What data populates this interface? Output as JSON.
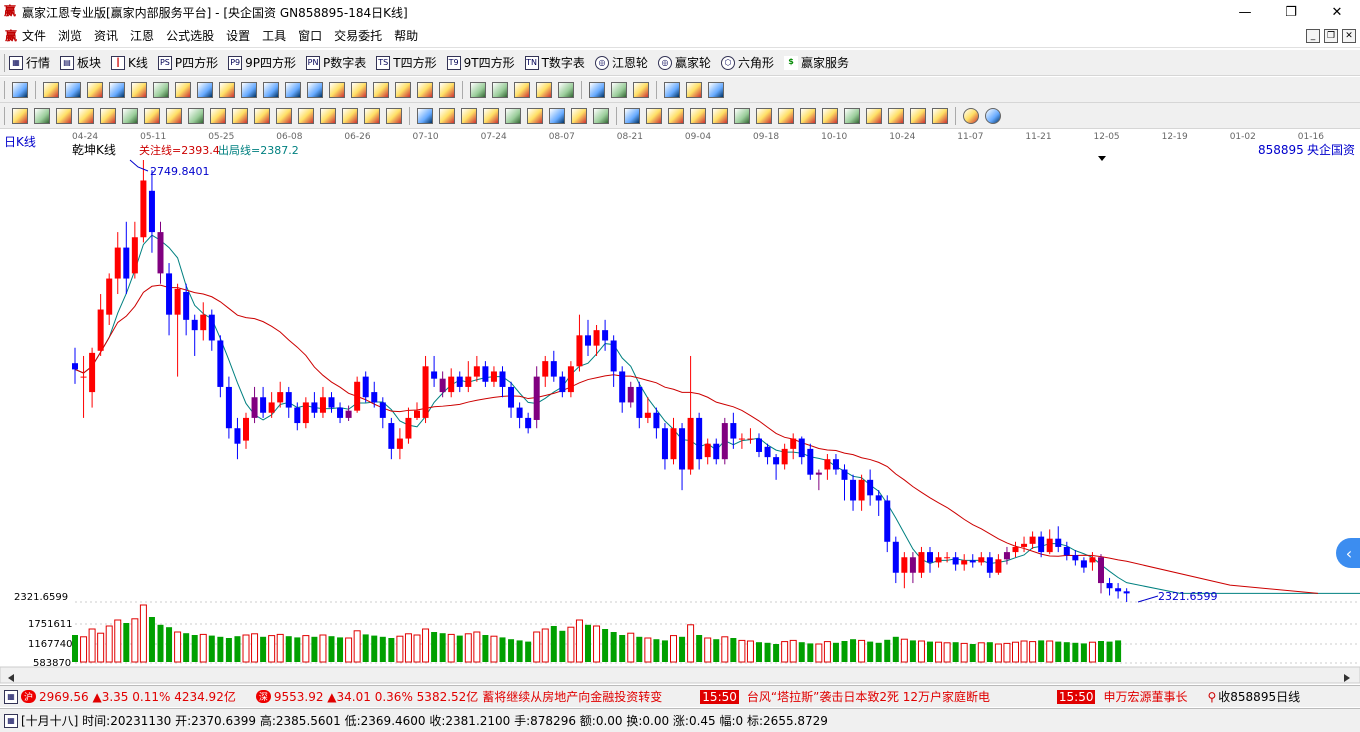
{
  "window": {
    "title": "赢家江恩专业版[赢家内部服务平台] - [央企国资  GN858895-184日K线]",
    "logo": "赢",
    "minimize": "—",
    "maximize": "❐",
    "close": "✕"
  },
  "menu": {
    "logo": "赢",
    "items": [
      "文件",
      "浏览",
      "资讯",
      "江恩",
      "公式选股",
      "设置",
      "工具",
      "窗口",
      "交易委托",
      "帮助"
    ]
  },
  "toolbar1": [
    {
      "icon": "grid-icon",
      "label": "行情"
    },
    {
      "icon": "blocks-icon",
      "label": "板块"
    },
    {
      "icon": "kline-icon",
      "label": "K线"
    },
    {
      "icon": "PS",
      "label": "P四方形"
    },
    {
      "icon": "P9",
      "label": "9P四方形"
    },
    {
      "icon": "PN",
      "label": "P数字表"
    },
    {
      "icon": "TS",
      "label": "T四方形"
    },
    {
      "icon": "T9",
      "label": "9T四方形"
    },
    {
      "icon": "TN",
      "label": "T数字表"
    },
    {
      "icon": "wheel-icon",
      "label": "江恩轮"
    },
    {
      "icon": "wheel-icon",
      "label": "赢家轮"
    },
    {
      "icon": "wheel-icon",
      "label": "六角形"
    },
    {
      "icon": "dollar-icon",
      "label": "赢家服务"
    }
  ],
  "chart": {
    "period_label": "日K线",
    "indicator_name": "乾坤K线",
    "focus_line_label": "关注线=2393.4",
    "exit_line_label": "出局线=2387.2",
    "code": "858895",
    "name": "央企国资",
    "high_label": "2749.8401",
    "low_label": "2321.6599",
    "axis_price_label": "2321.6599",
    "vol_labels": [
      "1751611",
      "1167740",
      "583870"
    ],
    "dates": [
      "04-24",
      "05-11",
      "05-25",
      "06-08",
      "06-26",
      "07-10",
      "07-24",
      "08-07",
      "08-21",
      "09-04",
      "09-18",
      "10-10",
      "10-24",
      "11-07",
      "11-21",
      "12-05",
      "12-19",
      "01-02",
      "01-16"
    ],
    "colors": {
      "up": "#ff0000",
      "down": "#0000ff",
      "purple": "#800080",
      "ma_short": "#008080",
      "ma_long": "#cc0000",
      "vol_up": "#e00000",
      "vol_down": "#00a000"
    }
  },
  "chart_data": {
    "type": "candlestick",
    "price_range": [
      2321.6599,
      2749.8401
    ],
    "candles": [
      [
        2553,
        2547,
        2568,
        2533
      ],
      [
        2540,
        2540,
        2560,
        2500
      ],
      [
        2525,
        2563,
        2568,
        2510
      ],
      [
        2565,
        2605,
        2620,
        2560
      ],
      [
        2600,
        2635,
        2640,
        2590
      ],
      [
        2635,
        2665,
        2680,
        2620
      ],
      [
        2665,
        2635,
        2690,
        2620
      ],
      [
        2640,
        2675,
        2690,
        2635
      ],
      [
        2675,
        2730,
        2749.84,
        2670
      ],
      [
        2720,
        2680,
        2740,
        2660
      ],
      [
        2680,
        2640,
        2690,
        2630
      ],
      [
        2640,
        2600,
        2650,
        2580
      ],
      [
        2600,
        2625,
        2630,
        2540
      ],
      [
        2622,
        2595,
        2630,
        2580
      ],
      [
        2595,
        2585,
        2600,
        2560
      ],
      [
        2585,
        2600,
        2612,
        2575
      ],
      [
        2600,
        2575,
        2605,
        2565
      ],
      [
        2575,
        2530,
        2580,
        2520
      ],
      [
        2530,
        2490,
        2540,
        2480
      ],
      [
        2490,
        2475,
        2500,
        2460
      ],
      [
        2478,
        2500,
        2505,
        2470
      ],
      [
        2500,
        2520,
        2530,
        2495
      ],
      [
        2520,
        2505,
        2530,
        2500
      ],
      [
        2505,
        2515,
        2525,
        2500
      ],
      [
        2515,
        2525,
        2535,
        2510
      ],
      [
        2525,
        2510,
        2530,
        2500
      ],
      [
        2510,
        2495,
        2515,
        2488
      ],
      [
        2495,
        2515,
        2520,
        2490
      ],
      [
        2515,
        2505,
        2525,
        2500
      ],
      [
        2505,
        2520,
        2530,
        2500
      ],
      [
        2520,
        2510,
        2525,
        2505
      ],
      [
        2510,
        2500,
        2515,
        2495
      ],
      [
        2500,
        2507,
        2512,
        2497
      ],
      [
        2507,
        2535,
        2540,
        2505
      ],
      [
        2540,
        2520,
        2545,
        2515
      ],
      [
        2525,
        2515,
        2535,
        2510
      ],
      [
        2515,
        2500,
        2520,
        2490
      ],
      [
        2495,
        2470,
        2500,
        2460
      ],
      [
        2470,
        2480,
        2490,
        2460
      ],
      [
        2480,
        2500,
        2510,
        2475
      ],
      [
        2500,
        2507,
        2515,
        2498
      ],
      [
        2500,
        2550,
        2560,
        2495
      ],
      [
        2545,
        2538,
        2560,
        2530
      ],
      [
        2538,
        2525,
        2545,
        2520
      ],
      [
        2525,
        2540,
        2548,
        2520
      ],
      [
        2540,
        2530,
        2545,
        2525
      ],
      [
        2530,
        2540,
        2555,
        2525
      ],
      [
        2540,
        2550,
        2560,
        2535
      ],
      [
        2550,
        2535,
        2555,
        2530
      ],
      [
        2535,
        2545,
        2550,
        2530
      ],
      [
        2545,
        2530,
        2550,
        2520
      ],
      [
        2530,
        2510,
        2535,
        2500
      ],
      [
        2510,
        2500,
        2515,
        2490
      ],
      [
        2500,
        2490,
        2505,
        2485
      ],
      [
        2498,
        2540,
        2550,
        2490
      ],
      [
        2540,
        2555,
        2560,
        2530
      ],
      [
        2555,
        2540,
        2565,
        2535
      ],
      [
        2540,
        2525,
        2545,
        2520
      ],
      [
        2525,
        2550,
        2555,
        2520
      ],
      [
        2550,
        2580,
        2600,
        2545
      ],
      [
        2580,
        2570,
        2595,
        2560
      ],
      [
        2570,
        2585,
        2590,
        2560
      ],
      [
        2585,
        2575,
        2595,
        2565
      ],
      [
        2575,
        2545,
        2580,
        2530
      ],
      [
        2545,
        2515,
        2550,
        2505
      ],
      [
        2515,
        2530,
        2535,
        2510
      ],
      [
        2530,
        2500,
        2535,
        2490
      ],
      [
        2500,
        2505,
        2520,
        2495
      ],
      [
        2505,
        2490,
        2510,
        2480
      ],
      [
        2490,
        2460,
        2495,
        2450
      ],
      [
        2460,
        2490,
        2500,
        2455
      ],
      [
        2490,
        2450,
        2495,
        2430
      ],
      [
        2450,
        2500,
        2560,
        2445
      ],
      [
        2500,
        2460,
        2505,
        2450
      ],
      [
        2462,
        2475,
        2480,
        2455
      ],
      [
        2475,
        2460,
        2480,
        2455
      ],
      [
        2460,
        2495,
        2500,
        2455
      ],
      [
        2495,
        2480,
        2505,
        2470
      ],
      [
        2480,
        2480,
        2485,
        2470
      ],
      [
        2480,
        2480,
        2490,
        2475
      ],
      [
        2480,
        2467,
        2485,
        2462
      ],
      [
        2472,
        2462,
        2475,
        2455
      ],
      [
        2462,
        2455,
        2465,
        2440
      ],
      [
        2455,
        2470,
        2475,
        2450
      ],
      [
        2470,
        2480,
        2485,
        2460
      ],
      [
        2480,
        2462,
        2482,
        2455
      ],
      [
        2470,
        2445,
        2475,
        2440
      ],
      [
        2445,
        2447,
        2450,
        2430
      ],
      [
        2450,
        2460,
        2465,
        2440
      ],
      [
        2460,
        2450,
        2465,
        2445
      ],
      [
        2450,
        2440,
        2455,
        2420
      ],
      [
        2440,
        2420,
        2445,
        2410
      ],
      [
        2420,
        2440,
        2445,
        2410
      ],
      [
        2440,
        2425,
        2450,
        2415
      ],
      [
        2425,
        2420,
        2430,
        2405
      ],
      [
        2420,
        2380,
        2425,
        2370
      ],
      [
        2380,
        2350,
        2385,
        2340
      ],
      [
        2350,
        2365,
        2370,
        2335
      ],
      [
        2365,
        2350,
        2370,
        2340
      ],
      [
        2350,
        2370,
        2375,
        2345
      ],
      [
        2370,
        2360,
        2375,
        2350
      ],
      [
        2360,
        2365,
        2370,
        2355
      ],
      [
        2365,
        2365,
        2370,
        2360
      ],
      [
        2365,
        2358,
        2370,
        2352
      ],
      [
        2358,
        2362,
        2368,
        2352
      ],
      [
        2362,
        2360,
        2368,
        2355
      ],
      [
        2360,
        2365,
        2370,
        2357
      ],
      [
        2365,
        2350,
        2370,
        2345
      ],
      [
        2350,
        2363,
        2368,
        2348
      ],
      [
        2363,
        2370,
        2375,
        2358
      ],
      [
        2370,
        2375,
        2380,
        2365
      ],
      [
        2375,
        2378,
        2385,
        2370
      ],
      [
        2378,
        2385,
        2390,
        2373
      ],
      [
        2385,
        2370,
        2390,
        2365
      ],
      [
        2370,
        2383,
        2392,
        2368
      ],
      [
        2383,
        2375,
        2395,
        2370
      ],
      [
        2375,
        2367,
        2380,
        2362
      ],
      [
        2367,
        2362,
        2372,
        2357
      ],
      [
        2362,
        2355,
        2365,
        2350
      ],
      [
        2360,
        2365,
        2370,
        2352
      ],
      [
        2365,
        2340,
        2368,
        2330
      ],
      [
        2340,
        2335,
        2345,
        2328
      ],
      [
        2335,
        2332,
        2340,
        2325
      ],
      [
        2332,
        2330,
        2335,
        2321.66
      ]
    ],
    "volume": [
      0.45,
      0.42,
      0.55,
      0.48,
      0.6,
      0.7,
      0.65,
      0.72,
      0.95,
      0.75,
      0.62,
      0.58,
      0.5,
      0.48,
      0.45,
      0.46,
      0.44,
      0.42,
      0.4,
      0.43,
      0.45,
      0.47,
      0.42,
      0.44,
      0.46,
      0.43,
      0.41,
      0.44,
      0.42,
      0.45,
      0.43,
      0.41,
      0.4,
      0.52,
      0.46,
      0.44,
      0.42,
      0.4,
      0.43,
      0.47,
      0.45,
      0.55,
      0.5,
      0.48,
      0.46,
      0.44,
      0.47,
      0.5,
      0.45,
      0.43,
      0.41,
      0.38,
      0.36,
      0.34,
      0.5,
      0.55,
      0.6,
      0.52,
      0.58,
      0.7,
      0.62,
      0.6,
      0.55,
      0.5,
      0.45,
      0.48,
      0.42,
      0.4,
      0.38,
      0.36,
      0.44,
      0.42,
      0.62,
      0.45,
      0.4,
      0.38,
      0.42,
      0.4,
      0.36,
      0.35,
      0.33,
      0.32,
      0.3,
      0.34,
      0.36,
      0.33,
      0.31,
      0.3,
      0.34,
      0.32,
      0.35,
      0.38,
      0.36,
      0.34,
      0.32,
      0.37,
      0.42,
      0.38,
      0.36,
      0.35,
      0.34,
      0.33,
      0.32,
      0.33,
      0.31,
      0.3,
      0.32,
      0.33,
      0.3,
      0.31,
      0.33,
      0.35,
      0.34,
      0.36,
      0.35,
      0.34,
      0.33,
      0.32,
      0.31,
      0.33,
      0.35,
      0.34,
      0.36
    ]
  },
  "status1": {
    "idx1_value": "2969.56",
    "idx1_change": "▲3.35",
    "idx1_pct": "0.11%",
    "idx1_amount": "4234.92亿",
    "idx2_value": "9553.92",
    "idx2_change": "▲34.01",
    "idx2_pct": "0.36%",
    "idx2_amount": "5382.52亿",
    "news1": "蓄将继续从房地产向金融投资转变",
    "time1": "15:50",
    "news2": "台风“塔拉斯”袭击日本致2死 12万户家庭断电",
    "time2": "15:50",
    "news3": "申万宏源董事长",
    "right": "收858895日线"
  },
  "status2": {
    "text": "[十月十八] 时间:20231130 开:2370.6399 高:2385.5601 低:2369.4600 收:2381.2100 手:878296 额:0.00 换:0.00 涨:0.45 幅:0 标:2655.8729"
  }
}
